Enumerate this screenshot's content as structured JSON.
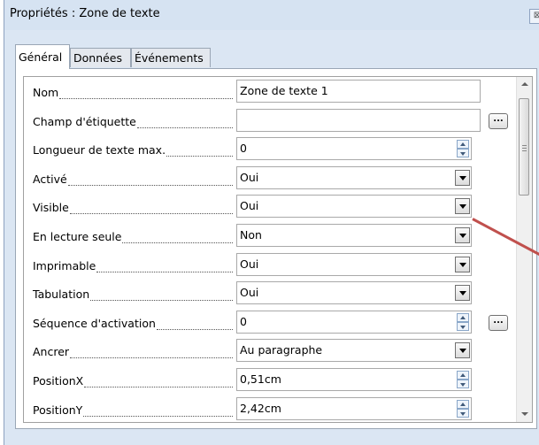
{
  "window": {
    "title": "Propriétés : Zone de texte"
  },
  "tabs": [
    {
      "label": "Général",
      "active": true
    },
    {
      "label": "Données",
      "active": false
    },
    {
      "label": "Événements",
      "active": false
    }
  ],
  "rows": [
    {
      "label": "Nom",
      "type": "text",
      "value": "Zone de texte 1",
      "ellipsis": false
    },
    {
      "label": "Champ d'étiquette",
      "type": "text",
      "value": "",
      "ellipsis": true
    },
    {
      "label": "Longueur de texte max.",
      "type": "spin",
      "value": "0",
      "ellipsis": false
    },
    {
      "label": "Activé",
      "type": "combo",
      "value": "Oui",
      "ellipsis": false
    },
    {
      "label": "Visible",
      "type": "combo",
      "value": "Oui",
      "ellipsis": false
    },
    {
      "label": "En lecture seule",
      "type": "combo",
      "value": "Non",
      "ellipsis": false
    },
    {
      "label": "Imprimable",
      "type": "combo",
      "value": "Oui",
      "ellipsis": false
    },
    {
      "label": "Tabulation",
      "type": "combo",
      "value": "Oui",
      "ellipsis": false
    },
    {
      "label": "Séquence d'activation",
      "type": "spin",
      "value": "0",
      "ellipsis": true
    },
    {
      "label": "Ancrer",
      "type": "combo",
      "value": "Au paragraphe",
      "ellipsis": false
    },
    {
      "label": "PositionX",
      "type": "spin",
      "value": "0,51cm",
      "ellipsis": false
    },
    {
      "label": "PositionY",
      "type": "spin",
      "value": "2,42cm",
      "ellipsis": false
    }
  ],
  "ellipsis_label": "...",
  "colors": {
    "window_bg": "#dbe6f3",
    "annotation_arrow": "#c0504d"
  }
}
